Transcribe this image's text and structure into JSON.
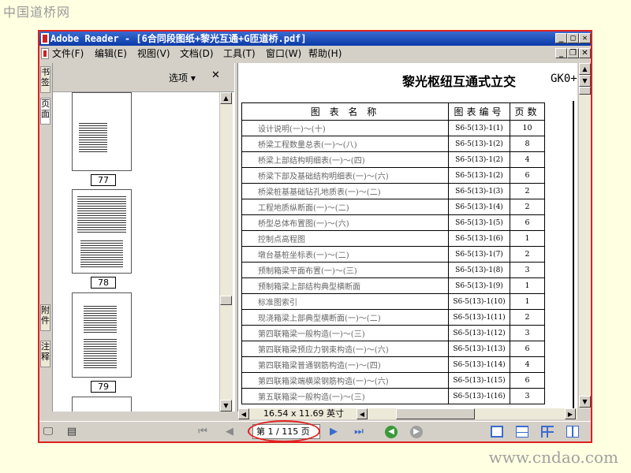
{
  "watermark_top": "中国道桥网",
  "watermark_bottom": "www.cndao.com",
  "window": {
    "title": "Adobe Reader - [6合同段图纸+黎光互通+G匝道桥.pdf]"
  },
  "menu": {
    "items": [
      "文件(F)",
      "编辑(E)",
      "视图(V)",
      "文档(D)",
      "工具(T)",
      "窗口(W)",
      "帮助(H)"
    ]
  },
  "nav_tabs": {
    "bookmarks": "书签",
    "pages": "页面",
    "attachments": "附件",
    "comments": "注释"
  },
  "pages_panel": {
    "options_label": "选项",
    "close_glyph": "✕",
    "thumb_labels": [
      "77",
      "78",
      "79"
    ]
  },
  "document": {
    "title": "黎光枢纽互通式立交",
    "code": "GK0+",
    "table": {
      "headers": [
        "图 表 名 称",
        "图表编号",
        "页数"
      ],
      "rows": [
        {
          "name": "设计说明(一)～(十)",
          "code": "S6-5(13)-1(1)",
          "pages": "10"
        },
        {
          "name": "桥梁工程数量总表(一)～(八)",
          "code": "S6-5(13)-1(2)",
          "pages": "8"
        },
        {
          "name": "桥梁上部结构明细表(一)～(四)",
          "code": "S6-5(13)-1(2)",
          "pages": "4"
        },
        {
          "name": "桥梁下部及基础结构明细表(一)～(六)",
          "code": "S6-5(13)-1(2)",
          "pages": "6"
        },
        {
          "name": "桥梁桩基基础钻孔地质表(一)～(二)",
          "code": "S6-5(13)-1(3)",
          "pages": "2"
        },
        {
          "name": "工程地质纵断面(一)～(二)",
          "code": "S6-5(13)-1(4)",
          "pages": "2"
        },
        {
          "name": "桥型总体布置图(一)～(六)",
          "code": "S6-5(13)-1(5)",
          "pages": "6"
        },
        {
          "name": "控制点高程图",
          "code": "S6-5(13)-1(6)",
          "pages": "1"
        },
        {
          "name": "墩台基桩坐标表(一)～(二)",
          "code": "S6-5(13)-1(7)",
          "pages": "2"
        },
        {
          "name": "预制箱梁平面布置(一)～(三)",
          "code": "S6-5(13)-1(8)",
          "pages": "3"
        },
        {
          "name": "预制箱梁上部结构典型横断面",
          "code": "S6-5(13)-1(9)",
          "pages": "1"
        },
        {
          "name": "标准图索引",
          "code": "S6-5(13)-1(10)",
          "pages": "1"
        },
        {
          "name": "现浇箱梁上部典型横断面(一)～(二)",
          "code": "S6-5(13)-1(11)",
          "pages": "2"
        },
        {
          "name": "第四联箱梁一般构造(一)～(三)",
          "code": "S6-5(13)-1(12)",
          "pages": "3"
        },
        {
          "name": "第四联箱梁预应力钢束构造(一)～(六)",
          "code": "S6-5(13)-1(13)",
          "pages": "6"
        },
        {
          "name": "第四联箱梁普通钢筋构造(一)～(四)",
          "code": "S6-5(13)-1(14)",
          "pages": "4"
        },
        {
          "name": "第四联箱梁端横梁钢筋构造(一)～(六)",
          "code": "S6-5(13)-1(15)",
          "pages": "6"
        },
        {
          "name": "第五联箱梁一般构造(一)～(三)",
          "code": "S6-5(13)-1(16)",
          "pages": "3"
        }
      ]
    }
  },
  "page_size": "16.54 x 11.69 英寸",
  "navigation": {
    "page_display": "第 1 / 115 页",
    "current_page": 1,
    "total_pages": 115
  },
  "colors": {
    "highlight": "#e02020",
    "titlebar": "#0a3aa8",
    "nav_green": "#3a9a3a",
    "layout_blue": "#3a6bd0"
  }
}
